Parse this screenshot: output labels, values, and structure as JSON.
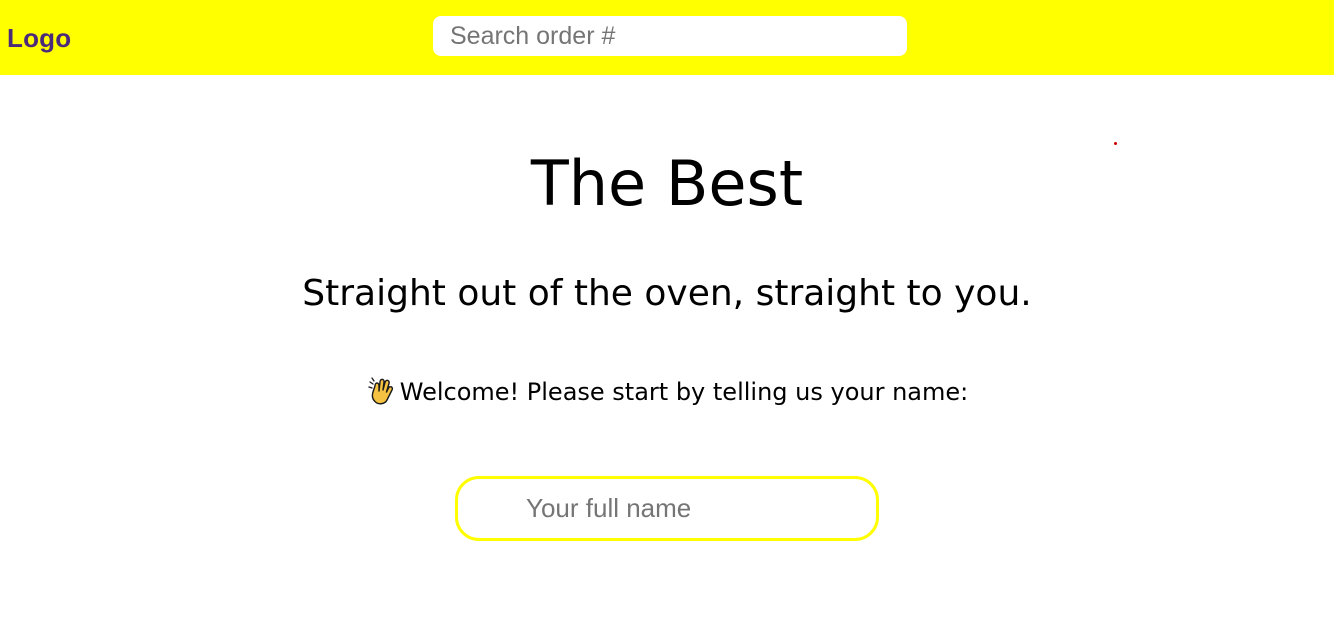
{
  "header": {
    "logo_text": "Logo",
    "search_placeholder": "Search order #"
  },
  "hero": {
    "title": "The Best",
    "subtitle": "Straight out of the oven, straight to you."
  },
  "welcome": {
    "icon": "waving-hand-icon",
    "text": "Welcome! Please start by telling us your name:"
  },
  "name_form": {
    "placeholder": "Your full name",
    "value": ""
  },
  "colors": {
    "header_background": "#ffff00",
    "logo": "#4b2a7a",
    "input_border": "#ffff00"
  }
}
